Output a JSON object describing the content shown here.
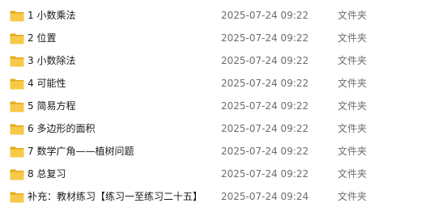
{
  "files": [
    {
      "name": "1 小数乘法",
      "modified": "2025-07-24 09:22",
      "type": "文件夹",
      "icon": "folder-icon"
    },
    {
      "name": "2 位置",
      "modified": "2025-07-24 09:22",
      "type": "文件夹",
      "icon": "folder-icon"
    },
    {
      "name": "3 小数除法",
      "modified": "2025-07-24 09:22",
      "type": "文件夹",
      "icon": "folder-icon"
    },
    {
      "name": "4 可能性",
      "modified": "2025-07-24 09:22",
      "type": "文件夹",
      "icon": "folder-icon"
    },
    {
      "name": "5 简易方程",
      "modified": "2025-07-24 09:22",
      "type": "文件夹",
      "icon": "folder-icon"
    },
    {
      "name": "6 多边形的面积",
      "modified": "2025-07-24 09:22",
      "type": "文件夹",
      "icon": "folder-icon"
    },
    {
      "name": "7 数学广角——植树问题",
      "modified": "2025-07-24 09:22",
      "type": "文件夹",
      "icon": "folder-icon"
    },
    {
      "name": "8 总复习",
      "modified": "2025-07-24 09:22",
      "type": "文件夹",
      "icon": "folder-icon"
    },
    {
      "name": "补充：教材练习【练习一至练习二十五】",
      "modified": "2025-07-24 09:24",
      "type": "文件夹",
      "icon": "folder-icon"
    }
  ],
  "colors": {
    "folder_body": "#f7c948",
    "folder_back": "#e6a817",
    "text": "#1a1a1a",
    "muted_text": "#6d6d6d"
  }
}
